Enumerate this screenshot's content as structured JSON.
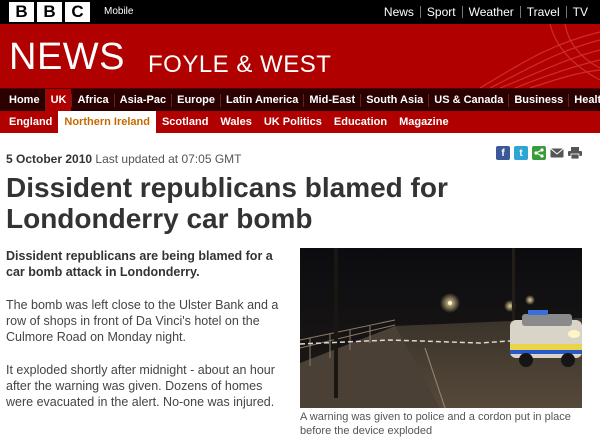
{
  "brand": {
    "logo_letters": [
      "B",
      "B",
      "C"
    ],
    "mobile_label": "Mobile"
  },
  "top_nav": [
    "News",
    "Sport",
    "Weather",
    "Travel",
    "TV"
  ],
  "masthead": {
    "title": "NEWS",
    "region": "FOYLE & WEST"
  },
  "nav_primary": {
    "items": [
      "Home",
      "UK",
      "Africa",
      "Asia-Pac",
      "Europe",
      "Latin America",
      "Mid-East",
      "South Asia",
      "US & Canada",
      "Business",
      "Healt"
    ],
    "active": "UK"
  },
  "nav_secondary": {
    "items": [
      "England",
      "Northern Ireland",
      "Scotland",
      "Wales",
      "UK Politics",
      "Education",
      "Magazine"
    ],
    "active": "Northern Ireland"
  },
  "article": {
    "date": "5 October 2010",
    "updated": "Last updated at 07:05 GMT",
    "headline": "Dissident republicans blamed for Londonderry car bomb",
    "intro": "Dissident republicans are being blamed for a car bomb attack in Londonderry.",
    "paragraphs": [
      "The bomb was left close to the Ulster Bank and a row of shops in front of Da Vinci's hotel on the Culmore Road on Monday night.",
      "It exploded shortly after midnight - about an hour after the warning was given. Dozens of homes were evacuated in the alert. No-one was injured."
    ],
    "photo_caption": "A warning was given to police and a cordon put in place before the device exploded"
  },
  "share_icons": [
    "facebook-icon",
    "twitter-icon",
    "share-icon",
    "email-icon",
    "print-icon"
  ],
  "colors": {
    "bbc_red": "#b00000",
    "nav_dark": "#2b0000",
    "active_orange": "#c46a00"
  }
}
